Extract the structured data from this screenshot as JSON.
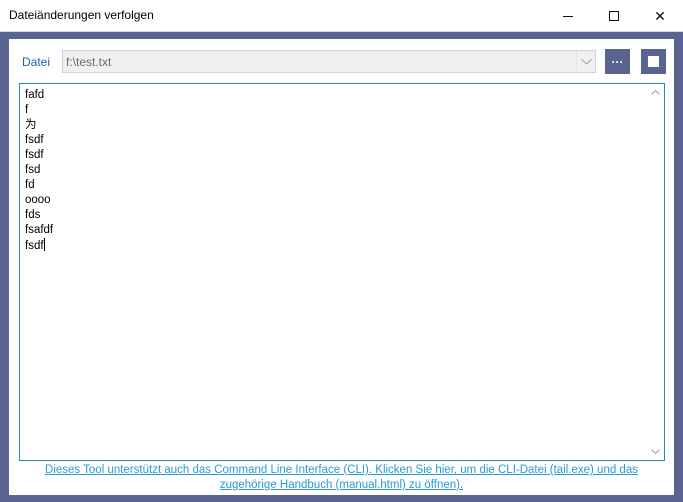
{
  "window": {
    "title": "Dateiänderungen verfolgen",
    "controls": {
      "minimize": "",
      "maximize": "",
      "close": "✕"
    }
  },
  "file_row": {
    "label": "Datei",
    "path_value": "f:\\test.txt",
    "browse_label": "···"
  },
  "editor": {
    "lines": [
      "fafd",
      "f",
      "为",
      "fsdf",
      "fsdf",
      "fsd",
      "fd",
      "oooo",
      "fds",
      "fsafdf",
      "fsdf"
    ]
  },
  "footer": {
    "line1": "Dieses Tool unterstützt auch das Command Line Interface (CLI). Klicken Sie hier, um die CLI-Datei (tail.exe) und das",
    "line2": "zugehörige Handbuch (manual.html) zu öffnen)."
  },
  "colors": {
    "frame": "#5a6490",
    "accent_link": "#2a9ad2",
    "label_blue": "#1f5fae",
    "textarea_border": "#2b8aa8"
  }
}
